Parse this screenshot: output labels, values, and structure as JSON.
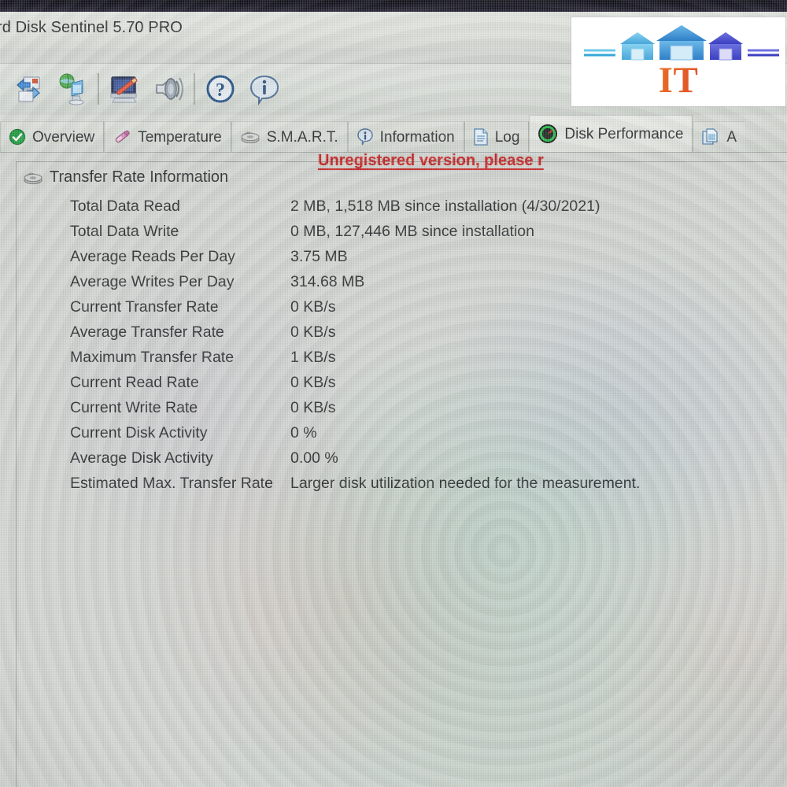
{
  "window": {
    "title": "rd Disk Sentinel 5.70 PRO"
  },
  "toolbar": {
    "buttons": [
      {
        "name": "refresh-icon",
        "tooltip": "Refresh"
      },
      {
        "name": "network-icon",
        "tooltip": "Network"
      },
      {
        "name": "configure-icon",
        "tooltip": "Configure"
      },
      {
        "name": "sound-icon",
        "tooltip": "Sound"
      },
      {
        "name": "help-icon",
        "tooltip": "Help"
      },
      {
        "name": "info-icon",
        "tooltip": "Information"
      }
    ],
    "unregistered_notice": "Unregistered version, please r"
  },
  "tabs": [
    {
      "label": "Overview",
      "icon": "green-check-icon",
      "active": false
    },
    {
      "label": "Temperature",
      "icon": "thermometer-icon",
      "active": false
    },
    {
      "label": "S.M.A.R.T.",
      "icon": "disk-icon",
      "active": false
    },
    {
      "label": "Information",
      "icon": "info-icon",
      "active": false
    },
    {
      "label": "Log",
      "icon": "document-icon",
      "active": false
    },
    {
      "label": "Disk Performance",
      "icon": "gauge-icon",
      "active": true
    },
    {
      "label": "A",
      "icon": "copy-icon",
      "active": false
    }
  ],
  "panel": {
    "section_title": "Transfer Rate Information",
    "section_icon": "disk-icon",
    "rows": [
      {
        "label": "Total Data Read",
        "value": "2 MB,  1,518 MB since installation  (4/30/2021)"
      },
      {
        "label": "Total Data Write",
        "value": "0 MB,  127,446 MB since installation"
      },
      {
        "label": "Average Reads Per Day",
        "value": "3.75 MB"
      },
      {
        "label": "Average Writes Per Day",
        "value": "314.68 MB"
      },
      {
        "label": "Current Transfer Rate",
        "value": "0 KB/s"
      },
      {
        "label": "Average Transfer Rate",
        "value": "0 KB/s"
      },
      {
        "label": "Maximum Transfer Rate",
        "value": "1 KB/s"
      },
      {
        "label": "Current Read Rate",
        "value": "0 KB/s"
      },
      {
        "label": "Current Write Rate",
        "value": "0 KB/s"
      },
      {
        "label": "Current Disk Activity",
        "value": "0 %"
      },
      {
        "label": "Average Disk Activity",
        "value": "0.00 %"
      },
      {
        "label": "Estimated Max. Transfer Rate",
        "value": "Larger disk utilization needed for the measurement."
      }
    ]
  },
  "watermark": {
    "text": "IT warehouse",
    "colors": {
      "house_light": "#5ab4e0",
      "house_mid": "#3d8fd4",
      "house_dark": "#4a4fd0",
      "text_start": "#f08a1c",
      "text_end": "#cf2026"
    }
  },
  "colors": {
    "bezel": "#0a0a14",
    "chrome": "#d9ded8",
    "text": "#2c2e30",
    "unregistered_red": "#c42222",
    "tab_active": "#e9ece6"
  }
}
